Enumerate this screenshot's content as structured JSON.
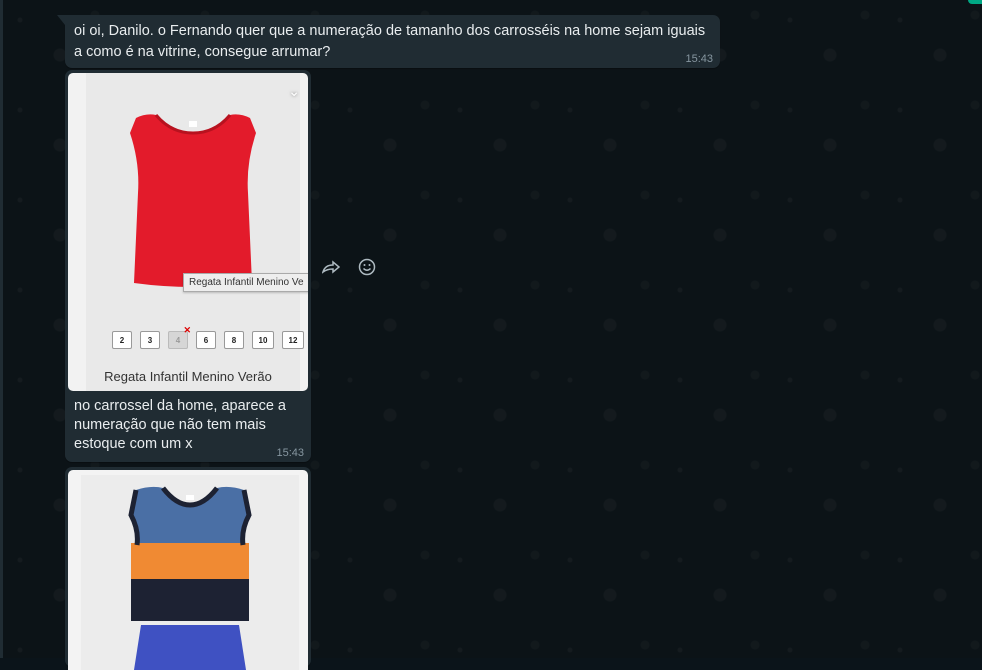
{
  "messages": [
    {
      "text": "oi oi, Danilo. o Fernando quer que a numeração de tamanho dos carrosséis na home sejam iguais a como é na vitrine, consegue arrumar?",
      "time": "15:43"
    },
    {
      "image": {
        "tooltip": "Regata Infantil Menino Ve",
        "product_name": "Regata Infantil Menino Verão",
        "sizes": [
          "2",
          "3",
          "4",
          "6",
          "8",
          "10",
          "12"
        ],
        "unavailable_size": "4"
      },
      "caption": "no carrossel da home, aparece a numeração que não tem mais estoque com um x",
      "time": "15:43"
    }
  ],
  "icons": {
    "forward": "forward-icon",
    "react": "emoji-icon",
    "menu": "chevron-down-icon"
  },
  "colors": {
    "bubble": "#202c33",
    "background": "#0c1317",
    "text": "#e9edef",
    "meta": "#8696a0",
    "accent": "#00a884",
    "shirt_red": "#e31b2b",
    "stripe_blue": "#4a6fa5",
    "stripe_orange": "#f08a33",
    "stripe_navy": "#1d2233",
    "shorts_blue": "#3f51c2"
  }
}
